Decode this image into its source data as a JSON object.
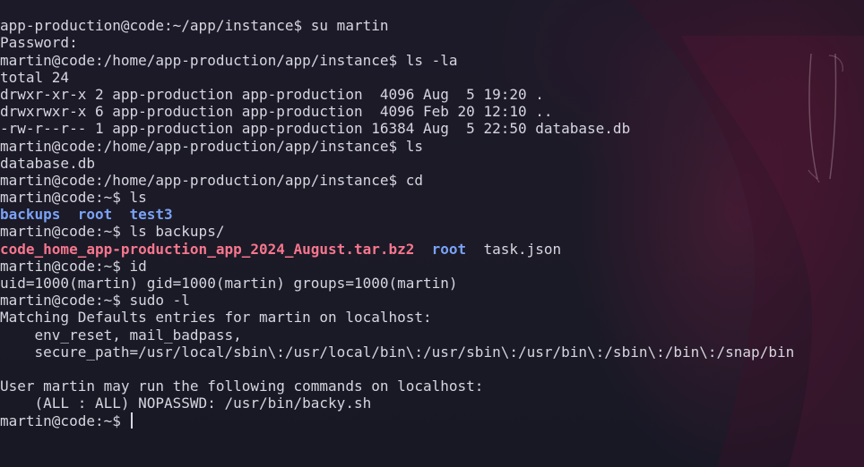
{
  "lines": [
    "app-production@code:~/app/instance$ su martin",
    "Password:",
    "martin@code:/home/app-production/app/instance$ ls -la",
    "total 24",
    "drwxr-xr-x 2 app-production app-production  4096 Aug  5 19:20 .",
    "drwxrwxr-x 6 app-production app-production  4096 Feb 20 12:10 ..",
    "-rw-r--r-- 1 app-production app-production 16384 Aug  5 22:50 database.db",
    "martin@code:/home/app-production/app/instance$ ls",
    "database.db",
    "martin@code:/home/app-production/app/instance$ cd",
    "martin@code:~$ ls",
    "",
    "martin@code:~$ ls backups/",
    "",
    "martin@code:~$ id",
    "uid=1000(martin) gid=1000(martin) groups=1000(martin)",
    "martin@code:~$ sudo -l",
    "Matching Defaults entries for martin on localhost:",
    "    env_reset, mail_badpass,",
    "    secure_path=/usr/local/sbin\\:/usr/local/bin\\:/usr/sbin\\:/usr/bin\\:/sbin\\:/bin\\:/snap/bin",
    "",
    "User martin may run the following commands on localhost:",
    "    (ALL : ALL) NOPASSWD: /usr/bin/backy.sh",
    "martin@code:~$ "
  ],
  "ls_home": {
    "items": [
      "backups",
      "root",
      "test3"
    ]
  },
  "ls_backups": {
    "archive": "code_home_app-production_app_2024_August.tar.bz2",
    "dir": "root",
    "file": "task.json"
  },
  "colors": {
    "background": "#1a1b26",
    "text": "#d6d6e0",
    "directory": "#7aa2f7",
    "archive": "#f7768e"
  }
}
